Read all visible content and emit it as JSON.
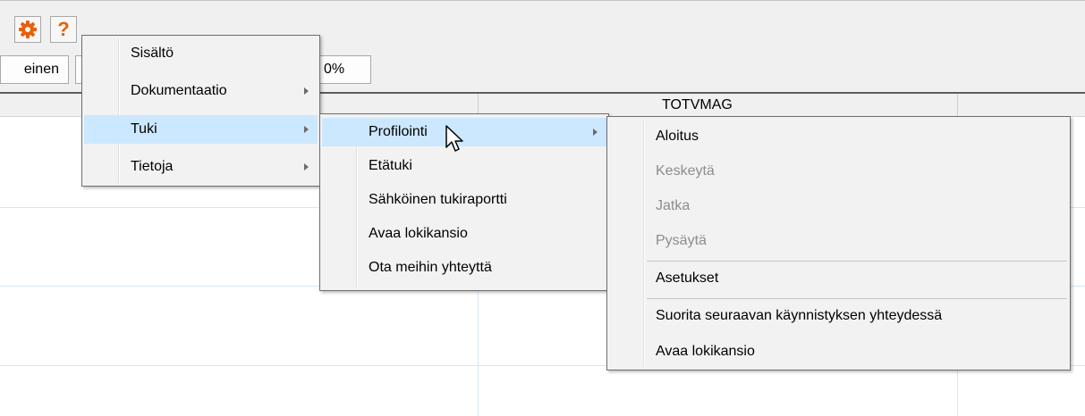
{
  "toolbar": {
    "button_1_label": "einen",
    "button_2_label": "",
    "button_3_label": "0%",
    "gear_icon": "gear-icon",
    "help_icon": "help-icon",
    "help_glyph": "?"
  },
  "table": {
    "column_header": "TOTVMAG"
  },
  "colors": {
    "highlight": "#cce8ff",
    "gear": "#e8600a",
    "disabled_text": "#8d8d8d"
  },
  "menu_main": {
    "items": [
      {
        "label": "Sisältö"
      },
      {
        "label": "Dokumentaatio"
      },
      {
        "label": "Tuki"
      },
      {
        "label": "Tietoja"
      }
    ]
  },
  "menu_tuki": {
    "items": [
      {
        "label": "Profilointi"
      },
      {
        "label": "Etätuki"
      },
      {
        "label": "Sähköinen tukiraportti"
      },
      {
        "label": "Avaa lokikansio"
      },
      {
        "label": "Ota meihin yhteyttä"
      }
    ]
  },
  "menu_profilointi": {
    "items": [
      {
        "label": "Aloitus"
      },
      {
        "label": "Keskeytä"
      },
      {
        "label": "Jatka"
      },
      {
        "label": "Pysäytä"
      },
      {
        "label": "Asetukset"
      },
      {
        "label": "Suorita seuraavan käynnistyksen yhteydessä"
      },
      {
        "label": "Avaa lokikansio"
      }
    ]
  }
}
